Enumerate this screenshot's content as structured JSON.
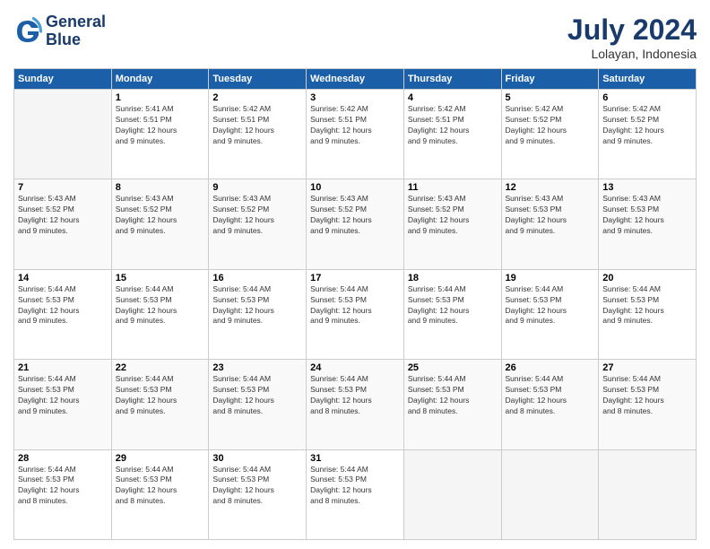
{
  "logo": {
    "line1": "General",
    "line2": "Blue"
  },
  "title": "July 2024",
  "subtitle": "Lolayan, Indonesia",
  "headers": [
    "Sunday",
    "Monday",
    "Tuesday",
    "Wednesday",
    "Thursday",
    "Friday",
    "Saturday"
  ],
  "weeks": [
    [
      {
        "day": "",
        "info": ""
      },
      {
        "day": "1",
        "info": "Sunrise: 5:41 AM\nSunset: 5:51 PM\nDaylight: 12 hours\nand 9 minutes."
      },
      {
        "day": "2",
        "info": "Sunrise: 5:42 AM\nSunset: 5:51 PM\nDaylight: 12 hours\nand 9 minutes."
      },
      {
        "day": "3",
        "info": "Sunrise: 5:42 AM\nSunset: 5:51 PM\nDaylight: 12 hours\nand 9 minutes."
      },
      {
        "day": "4",
        "info": "Sunrise: 5:42 AM\nSunset: 5:51 PM\nDaylight: 12 hours\nand 9 minutes."
      },
      {
        "day": "5",
        "info": "Sunrise: 5:42 AM\nSunset: 5:52 PM\nDaylight: 12 hours\nand 9 minutes."
      },
      {
        "day": "6",
        "info": "Sunrise: 5:42 AM\nSunset: 5:52 PM\nDaylight: 12 hours\nand 9 minutes."
      }
    ],
    [
      {
        "day": "7",
        "info": "Sunrise: 5:43 AM\nSunset: 5:52 PM\nDaylight: 12 hours\nand 9 minutes."
      },
      {
        "day": "8",
        "info": "Sunrise: 5:43 AM\nSunset: 5:52 PM\nDaylight: 12 hours\nand 9 minutes."
      },
      {
        "day": "9",
        "info": "Sunrise: 5:43 AM\nSunset: 5:52 PM\nDaylight: 12 hours\nand 9 minutes."
      },
      {
        "day": "10",
        "info": "Sunrise: 5:43 AM\nSunset: 5:52 PM\nDaylight: 12 hours\nand 9 minutes."
      },
      {
        "day": "11",
        "info": "Sunrise: 5:43 AM\nSunset: 5:52 PM\nDaylight: 12 hours\nand 9 minutes."
      },
      {
        "day": "12",
        "info": "Sunrise: 5:43 AM\nSunset: 5:53 PM\nDaylight: 12 hours\nand 9 minutes."
      },
      {
        "day": "13",
        "info": "Sunrise: 5:43 AM\nSunset: 5:53 PM\nDaylight: 12 hours\nand 9 minutes."
      }
    ],
    [
      {
        "day": "14",
        "info": "Sunrise: 5:44 AM\nSunset: 5:53 PM\nDaylight: 12 hours\nand 9 minutes."
      },
      {
        "day": "15",
        "info": "Sunrise: 5:44 AM\nSunset: 5:53 PM\nDaylight: 12 hours\nand 9 minutes."
      },
      {
        "day": "16",
        "info": "Sunrise: 5:44 AM\nSunset: 5:53 PM\nDaylight: 12 hours\nand 9 minutes."
      },
      {
        "day": "17",
        "info": "Sunrise: 5:44 AM\nSunset: 5:53 PM\nDaylight: 12 hours\nand 9 minutes."
      },
      {
        "day": "18",
        "info": "Sunrise: 5:44 AM\nSunset: 5:53 PM\nDaylight: 12 hours\nand 9 minutes."
      },
      {
        "day": "19",
        "info": "Sunrise: 5:44 AM\nSunset: 5:53 PM\nDaylight: 12 hours\nand 9 minutes."
      },
      {
        "day": "20",
        "info": "Sunrise: 5:44 AM\nSunset: 5:53 PM\nDaylight: 12 hours\nand 9 minutes."
      }
    ],
    [
      {
        "day": "21",
        "info": "Sunrise: 5:44 AM\nSunset: 5:53 PM\nDaylight: 12 hours\nand 9 minutes."
      },
      {
        "day": "22",
        "info": "Sunrise: 5:44 AM\nSunset: 5:53 PM\nDaylight: 12 hours\nand 9 minutes."
      },
      {
        "day": "23",
        "info": "Sunrise: 5:44 AM\nSunset: 5:53 PM\nDaylight: 12 hours\nand 8 minutes."
      },
      {
        "day": "24",
        "info": "Sunrise: 5:44 AM\nSunset: 5:53 PM\nDaylight: 12 hours\nand 8 minutes."
      },
      {
        "day": "25",
        "info": "Sunrise: 5:44 AM\nSunset: 5:53 PM\nDaylight: 12 hours\nand 8 minutes."
      },
      {
        "day": "26",
        "info": "Sunrise: 5:44 AM\nSunset: 5:53 PM\nDaylight: 12 hours\nand 8 minutes."
      },
      {
        "day": "27",
        "info": "Sunrise: 5:44 AM\nSunset: 5:53 PM\nDaylight: 12 hours\nand 8 minutes."
      }
    ],
    [
      {
        "day": "28",
        "info": "Sunrise: 5:44 AM\nSunset: 5:53 PM\nDaylight: 12 hours\nand 8 minutes."
      },
      {
        "day": "29",
        "info": "Sunrise: 5:44 AM\nSunset: 5:53 PM\nDaylight: 12 hours\nand 8 minutes."
      },
      {
        "day": "30",
        "info": "Sunrise: 5:44 AM\nSunset: 5:53 PM\nDaylight: 12 hours\nand 8 minutes."
      },
      {
        "day": "31",
        "info": "Sunrise: 5:44 AM\nSunset: 5:53 PM\nDaylight: 12 hours\nand 8 minutes."
      },
      {
        "day": "",
        "info": ""
      },
      {
        "day": "",
        "info": ""
      },
      {
        "day": "",
        "info": ""
      }
    ]
  ]
}
